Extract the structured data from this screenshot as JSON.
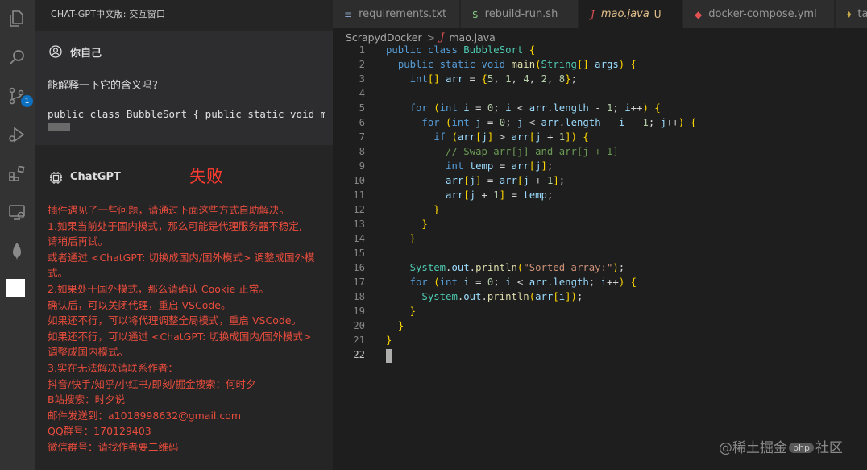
{
  "panel": {
    "title": "CHAT-GPT中文版: 交互窗口",
    "user_name": "你自己",
    "user_question": "能解释一下它的含义吗?",
    "user_code": "public class BubbleSort {   public static void main(String[] args) {",
    "bot_name": "ChatGPT",
    "fail_label": "失败",
    "bot_message": [
      "插件遇见了一些问题，请通过下面这些方式自助解决。",
      "1.如果当前处于国内模式，那么可能是代理服务器不稳定,",
      "请稍后再试。",
      "或者通过 <ChatGPT: 切换成国内/国外模式> 调整成国外模",
      "式。",
      "2.如果处于国外模式，那么请确认 Cookie 正常。",
      "确认后，可以关闭代理，重启 VSCode。",
      "如果还不行，可以将代理调整全局模式，重启 VSCode。",
      "如果还不行，可以通过 <ChatGPT: 切换成国内/国外模式>",
      "调整成国内模式。",
      "3.实在无法解决请联系作者：",
      "抖音/快手/知乎/小红书/即刻/掘金搜索：何时夕",
      "B站搜索：时夕说",
      "邮件发送到：a1018998632@gmail.com",
      "QQ群号：170129403",
      "微信群号：请找作者要二维码"
    ]
  },
  "activity": {
    "source_control_badge": "1"
  },
  "tabs": [
    {
      "icon": "≡",
      "label": "requirements.txt",
      "status": ""
    },
    {
      "icon": "$",
      "label": "rebuild-run.sh",
      "status": ""
    },
    {
      "icon": "J",
      "label": "mao.java",
      "status": "U"
    },
    {
      "icon": "◆",
      "label": "docker-compose.yml",
      "status": ""
    },
    {
      "icon": "",
      "label": "ta",
      "status": ""
    }
  ],
  "breadcrumb": {
    "folder": "ScrapydDocker",
    "sep": ">",
    "file_icon": "J",
    "file": "mao.java"
  },
  "code": {
    "line_numbers": [
      "1",
      "2",
      "3",
      "4",
      "5",
      "6",
      "7",
      "8",
      "9",
      "10",
      "11",
      "12",
      "13",
      "14",
      "15",
      "16",
      "17",
      "18",
      "19",
      "20",
      "21",
      "22"
    ],
    "lines": [
      "public class BubbleSort {",
      "  public static void main(String[] args) {",
      "    int[] arr = {5, 1, 4, 2, 8};",
      "",
      "    for (int i = 0; i < arr.length - 1; i++) {",
      "      for (int j = 0; j < arr.length - i - 1; j++) {",
      "        if (arr[j] > arr[j + 1]) {",
      "          // Swap arr[j] and arr[j + 1]",
      "          int temp = arr[j];",
      "          arr[j] = arr[j + 1];",
      "          arr[j + 1] = temp;",
      "        }",
      "      }",
      "    }",
      "",
      "    System.out.println(\"Sorted array:\");",
      "    for (int i = 0; i < arr.length; i++) {",
      "      System.out.println(arr[i]);",
      "    }",
      "  }",
      "}",
      ""
    ]
  },
  "watermark": {
    "prefix": "@稀土掘金",
    "php": "php",
    "suffix": "社区"
  },
  "colors": {
    "fail": "#ff3b30",
    "error_text": "#e74c3c",
    "accent_blue": "#0e70c0"
  }
}
